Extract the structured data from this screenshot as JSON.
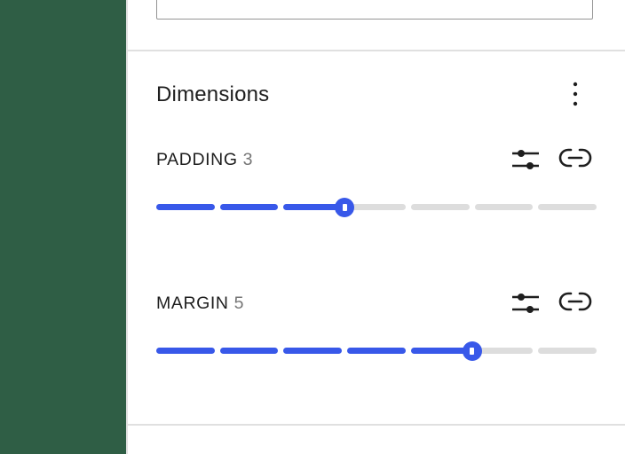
{
  "colors": {
    "sidebar": "#2f5e45",
    "accent": "#3858e9",
    "track": "#dddddd",
    "text": "#1e1e1e",
    "muted": "#757575"
  },
  "dimensions": {
    "title": "Dimensions",
    "menu_icon": "more-vertical-icon",
    "padding": {
      "label": "PADDING",
      "value": "3",
      "steps": 7,
      "level": 3,
      "custom_icon": "sliders-icon",
      "link_icon": "link-icon"
    },
    "margin": {
      "label": "MARGIN",
      "value": "5",
      "steps": 7,
      "level": 5,
      "custom_icon": "sliders-icon",
      "link_icon": "link-icon"
    }
  }
}
